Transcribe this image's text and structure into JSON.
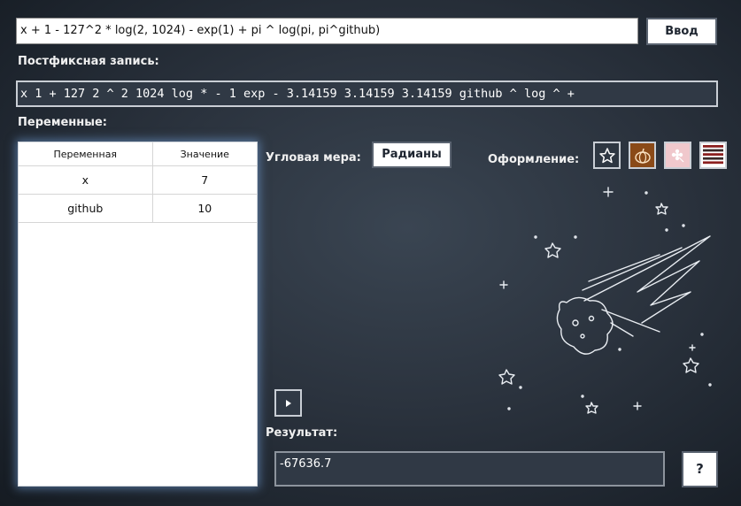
{
  "expression": {
    "value": "x + 1 - 127^2 * log(2, 1024) - exp(1) + pi ^ log(pi, pi^github)"
  },
  "enter_button": {
    "label": "Ввод"
  },
  "postfix": {
    "label": "Постфиксная запись:",
    "value": "x 1 + 127 2 ^ 2 1024 log * - 1 exp - 3.14159 3.14159 3.14159 github ^ log ^ +"
  },
  "variables": {
    "label": "Переменные:",
    "headers": [
      "Переменная",
      "Значение"
    ],
    "rows": [
      {
        "name": "x",
        "value": "7"
      },
      {
        "name": "github",
        "value": "10"
      }
    ]
  },
  "angle": {
    "label": "Угловая мера:",
    "button": "Радианы"
  },
  "theme": {
    "label": "Оформление:",
    "options": [
      {
        "icon": "star-icon",
        "color": "#2e3742"
      },
      {
        "icon": "pumpkin-icon",
        "color": "#8a4a18"
      },
      {
        "icon": "flower-icon",
        "color": "#f0c8cc"
      },
      {
        "icon": "stripes-icon",
        "color": "#8b1e1e"
      }
    ]
  },
  "result": {
    "label": "Результат:",
    "value": "-67636.7"
  },
  "help_button": {
    "label": "?"
  }
}
